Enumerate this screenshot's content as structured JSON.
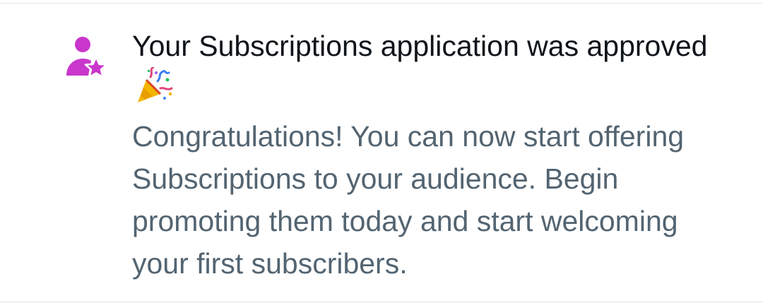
{
  "notification": {
    "icon": "person-star-icon",
    "icon_color": "#c936cc",
    "title": "Your Subscriptions application was approved",
    "title_emoji": "party-popper-icon",
    "body": "Congratulations! You can now start offering Subscriptions to your audience. Begin promoting them today and start welcoming your first subscribers."
  },
  "colors": {
    "title": "#0f1419",
    "body": "#536471",
    "divider": "#e1e6ea"
  }
}
